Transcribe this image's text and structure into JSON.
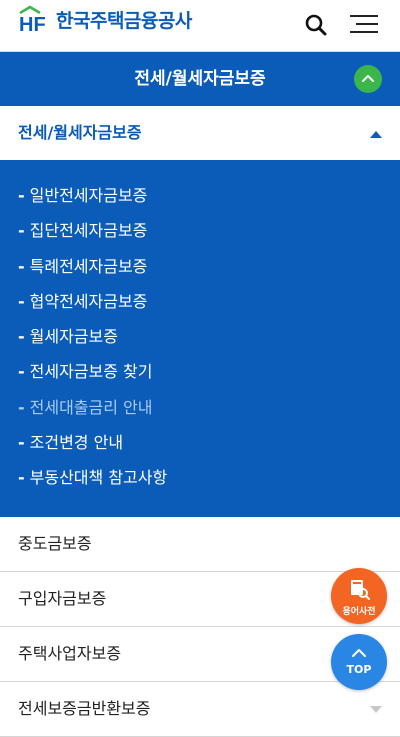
{
  "header": {
    "logo_mark": "HF",
    "logo_name": "한국주택금융공사",
    "icons": {
      "search": "search-icon",
      "menu": "hamburger-menu-icon"
    }
  },
  "title_bar": {
    "title": "전세/월세자금보증",
    "icon": "chevron-up-icon"
  },
  "active_section": {
    "label": "전세/월세자금보증",
    "submenu": [
      "일반전세자금보증",
      "집단전세자금보증",
      "특례전세자금보증",
      "협약전세자금보증",
      "월세자금보증",
      "전세자금보증 찾기",
      "전세대출금리 안내",
      "조건변경 안내",
      "부동산대책 참고사항"
    ],
    "dash": "-"
  },
  "sections": [
    "중도금보증",
    "구입자금보증",
    "주택사업자보증",
    "전세보증금반환보증"
  ],
  "floating": {
    "dictionary_label": "용어사전",
    "top_label": "TOP"
  },
  "colors": {
    "brand_blue": "#0a5cb8",
    "accent_green": "#3cb54a",
    "dict_orange": "#f26522",
    "top_blue": "#2a86e4"
  }
}
